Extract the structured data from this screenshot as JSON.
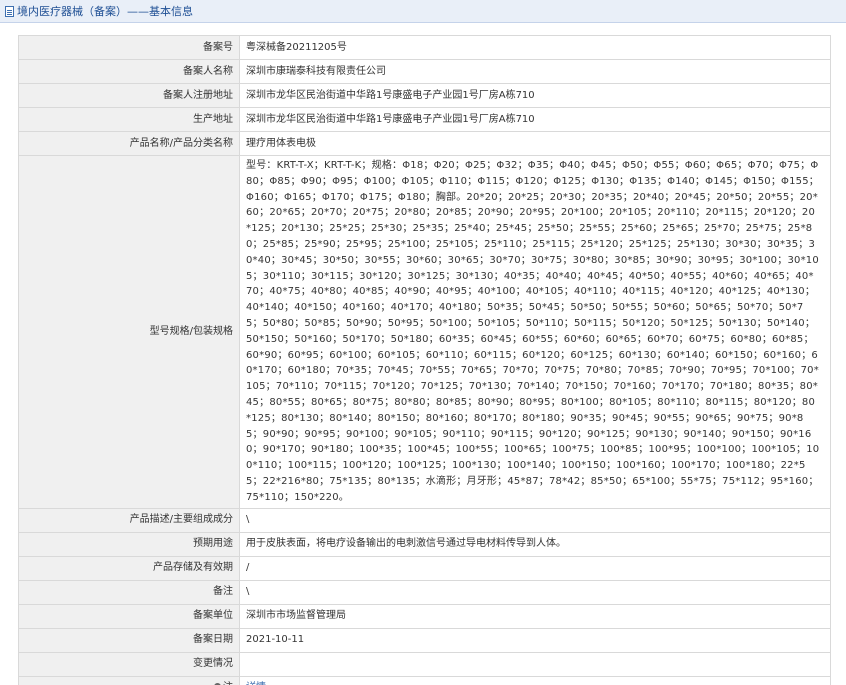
{
  "header": {
    "title": "境内医疗器械（备案）——基本信息",
    "icon": "document-icon"
  },
  "rows": [
    {
      "label": "备案号",
      "value": "粤深械备20211205号"
    },
    {
      "label": "备案人名称",
      "value": "深圳市康瑞泰科技有限责任公司"
    },
    {
      "label": "备案人注册地址",
      "value": "深圳市龙华区民治街道中华路1号康盛电子产业园1号厂房A栋710"
    },
    {
      "label": "生产地址",
      "value": "深圳市龙华区民治街道中华路1号康盛电子产业园1号厂房A栋710"
    },
    {
      "label": "产品名称/产品分类名称",
      "value": "理疗用体表电极"
    },
    {
      "label": "型号规格/包装规格",
      "value": "型号：KRT-T-X；KRT-T-K；规格：Φ18；Φ20；Φ25；Φ32；Φ35；Φ40；Φ45；Φ50；Φ55；Φ60；Φ65；Φ70；Φ75；Φ80；Φ85；Φ90；Φ95；Φ100；Φ105；Φ110；Φ115；Φ120；Φ125；Φ130；Φ135；Φ140；Φ145；Φ150；Φ155；Φ160；Φ165；Φ170；Φ175；Φ180；胸部。20*20；20*25；20*30；20*35；20*40；20*45；20*50；20*55；20*60；20*65；20*70；20*75；20*80；20*85；20*90；20*95；20*100；20*105；20*110；20*115；20*120；20*125；20*130；25*25；25*30；25*35；25*40；25*45；25*50；25*55；25*60；25*65；25*70；25*75；25*80；25*85；25*90；25*95；25*100；25*105；25*110；25*115；25*120；25*125；25*130；30*30；30*35；30*40；30*45；30*50；30*55；30*60；30*65；30*70；30*75；30*80；30*85；30*90；30*95；30*100；30*105；30*110；30*115；30*120；30*125；30*130；40*35；40*40；40*45；40*50；40*55；40*60；40*65；40*70；40*75；40*80；40*85；40*90；40*95；40*100；40*105；40*110；40*115；40*120；40*125；40*130；40*140；40*150；40*160；40*170；40*180；50*35；50*45；50*50；50*55；50*60；50*65；50*70；50*75；50*80；50*85；50*90；50*95；50*100；50*105；50*110；50*115；50*120；50*125；50*130；50*140；50*150；50*160；50*170；50*180；60*35；60*45；60*55；60*60；60*65；60*70；60*75；60*80；60*85；60*90；60*95；60*100；60*105；60*110；60*115；60*120；60*125；60*130；60*140；60*150；60*160；60*170；60*180；70*35；70*45；70*55；70*65；70*70；70*75；70*80；70*85；70*90；70*95；70*100；70*105；70*110；70*115；70*120；70*125；70*130；70*140；70*150；70*160；70*170；70*180；80*35；80*45；80*55；80*65；80*75；80*80；80*85；80*90；80*95；80*100；80*105；80*110；80*115；80*120；80*125；80*130；80*140；80*150；80*160；80*170；80*180；90*35；90*45；90*55；90*65；90*75；90*85；90*90；90*95；90*100；90*105；90*110；90*115；90*120；90*125；90*130；90*140；90*150；90*160；90*170；90*180；100*35；100*45；100*55；100*65；100*75；100*85；100*95；100*100；100*105；100*110；100*115；100*120；100*125；100*130；100*140；100*150；100*160；100*170；100*180；22*55；22*216*80；75*135；80*135；水滴形；月牙形；45*87；78*42；85*50；65*100；55*75；75*112；95*160；75*110；150*220。"
    },
    {
      "label": "产品描述/主要组成成分",
      "value": "\\"
    },
    {
      "label": "预期用途",
      "value": "用于皮肤表面，将电疗设备输出的电刺激信号通过导电材料传导到人体。"
    },
    {
      "label": "产品存储及有效期",
      "value": "/"
    },
    {
      "label": "备注",
      "value": "\\"
    },
    {
      "label": "备案单位",
      "value": "深圳市市场监督管理局"
    },
    {
      "label": "备案日期",
      "value": "2021-10-11"
    },
    {
      "label": "变更情况",
      "value": ""
    },
    {
      "label": "注",
      "value": "详情",
      "icon": "pin-icon"
    }
  ]
}
